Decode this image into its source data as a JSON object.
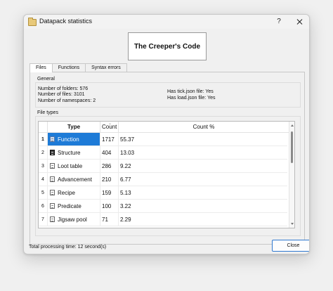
{
  "window": {
    "title": "Datapack statistics",
    "help_label": "?"
  },
  "logo": {
    "text": "The Creeper's Code"
  },
  "tabs": [
    {
      "label": "Files",
      "active": true
    },
    {
      "label": "Functions",
      "active": false
    },
    {
      "label": "Syntax errors",
      "active": false
    }
  ],
  "general": {
    "label": "General",
    "folders": "Number of folders: 576",
    "files": "Number of files: 3101",
    "namespaces": "Number of namespaces: 2",
    "tick": "Has tick.json file: Yes",
    "load": "Has load.json file: Yes"
  },
  "file_types": {
    "label": "File types",
    "columns": {
      "type": "Type",
      "count": "Count",
      "pct": "Count %"
    },
    "rows": [
      {
        "num": "1",
        "type": "Function",
        "count": "1717",
        "pct": "55.37",
        "icon": "function-file-icon",
        "selected": true
      },
      {
        "num": "2",
        "type": "Structure",
        "count": "404",
        "pct": "13.03",
        "icon": "structure-file-icon",
        "selected": false
      },
      {
        "num": "3",
        "type": "Loot table",
        "count": "286",
        "pct": "9.22",
        "icon": "json-file-icon",
        "selected": false
      },
      {
        "num": "4",
        "type": "Advancement",
        "count": "210",
        "pct": "6.77",
        "icon": "json-file-icon",
        "selected": false
      },
      {
        "num": "5",
        "type": "Recipe",
        "count": "159",
        "pct": "5.13",
        "icon": "json-file-icon",
        "selected": false
      },
      {
        "num": "6",
        "type": "Predicate",
        "count": "100",
        "pct": "3.22",
        "icon": "json-file-icon",
        "selected": false
      },
      {
        "num": "7",
        "type": "Jigsaw pool",
        "count": "71",
        "pct": "2.29",
        "icon": "json-file-icon",
        "selected": false
      }
    ]
  },
  "footer": {
    "processing": "Total processing time: 12 second(s)",
    "close_label": "Close"
  },
  "colors": {
    "selection": "#1e7bd7",
    "close_border": "#2f78cf"
  }
}
